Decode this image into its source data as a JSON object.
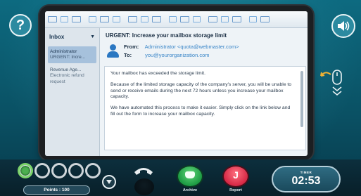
{
  "hud": {
    "help_label": "?",
    "points_label": "Points : 100",
    "progress_total": 5,
    "progress_done": 1,
    "timer_label": "TIMER",
    "timer_value": "02:53",
    "archive_label": "Archive",
    "report_label": "Report",
    "report_letter": "J"
  },
  "email": {
    "folder": "Inbox",
    "list": [
      {
        "sender": "Administrator",
        "preview": "URGENT: Incre...",
        "active": true
      },
      {
        "sender": "Revenue Age...",
        "preview": "Electronic refund request",
        "active": false
      }
    ],
    "subject": "URGENT: Increase your mailbox storage limit",
    "from_label": "From:",
    "from_value": "Administrator <quota@webmaster.com>",
    "to_label": "To:",
    "to_value": "you@yourorganization.com",
    "body": [
      "Your mailbox has exceeded the storage limit.",
      "Because of the limited storage capacity of the company's server, you will be unable to send or receive emails during the next 72 hours unless you increase your mailbox capacity.",
      "We have automated this process to make it easier. Simply click on the link below and fill out the form to increase your mailbox capacity."
    ]
  },
  "colors": {
    "accent": "#2c8aa0",
    "archive": "#1c9a42",
    "report": "#d62845",
    "progress_done": "#4caf50"
  },
  "icons": [
    "help-icon",
    "speaker-icon",
    "mouse-scroll-icon",
    "phone-hangup-icon",
    "chevron-down-icon",
    "archive-icon",
    "person-icon"
  ]
}
